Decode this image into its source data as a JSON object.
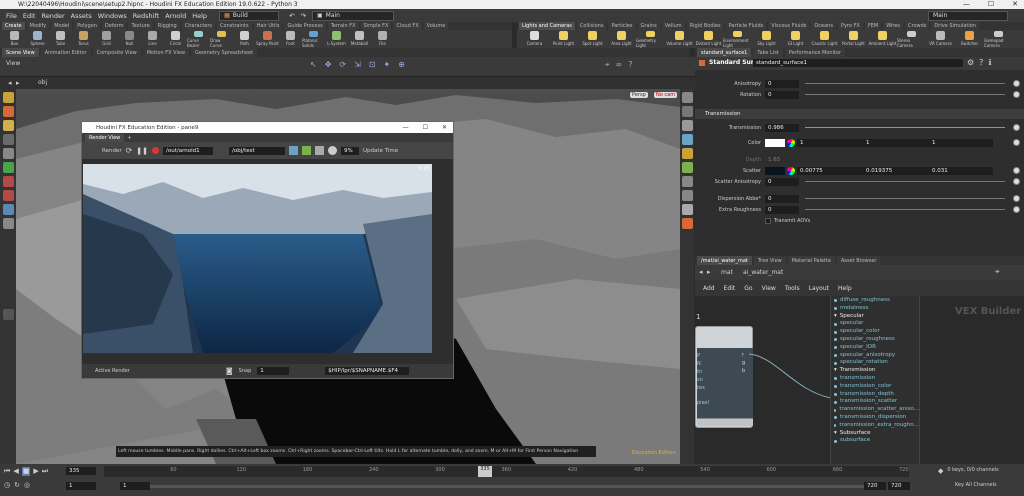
{
  "title": "W:\\22040496\\Houdini\\scene\\setup2.hipnc - Houdini FX Education Edition 19.0.622 - Python 3",
  "menu": [
    "File",
    "Edit",
    "Render",
    "Assets",
    "Windows",
    "Redshift",
    "Arnold",
    "Help"
  ],
  "build": "Build",
  "main_desk": "Main",
  "right_desk": "Main",
  "shelf_tabs_left": [
    "Create",
    "Modify",
    "Model",
    "Polygon",
    "Deform",
    "Texture",
    "Rigging",
    "Characters",
    "Constraints",
    "Hair Utils",
    "Guide Process",
    "Terrain FX",
    "Simple FX",
    "Cloud FX",
    "Volume"
  ],
  "shelf_tools_left": [
    "Box",
    "Sphere",
    "Tube",
    "Torus",
    "Grid",
    "Null",
    "Line",
    "Circle",
    "Curve Bezier",
    "Draw Curve",
    "Path",
    "Spray Paint",
    "Font",
    "Platonic Solids",
    "L-System",
    "Metaball",
    "File"
  ],
  "shelf_tabs_right": [
    "Lights and Cameras",
    "Collisions",
    "Particles",
    "Grains",
    "Vellum",
    "Rigid Bodies",
    "Particle Fluids",
    "Viscous Fluids",
    "Oceans",
    "Pyro FX",
    "FEM",
    "Wires",
    "Crowds",
    "Drive Simulation"
  ],
  "shelf_tools_right": [
    "Camera",
    "Point Light",
    "Spot Light",
    "Area Light",
    "Geometry Light",
    "Volume Light",
    "Distant Light",
    "Environment Light",
    "Sky Light",
    "GI Light",
    "Caustic Light",
    "Portal Light",
    "Ambient Light",
    "Stereo Camera",
    "VR Camera",
    "Switcher",
    "Gamepad Camera"
  ],
  "pane_tabs_left": [
    "Scene View",
    "Animation Editor",
    "Composite View",
    "Motion FX View",
    "Geometry Spreadsheet"
  ],
  "pane_tabs_right": [
    "standard_surface1",
    "Take List",
    "Performance Monitor"
  ],
  "viewer": {
    "title": "View",
    "path": "obj",
    "persp": "Persp",
    "cam": "No cam"
  },
  "render_view": {
    "title": "Houdini FX Education Edition - pane9",
    "tab": "Render View",
    "render_label": "Render",
    "out_path": "/out/arnold1",
    "obj_path": "/obj/test",
    "zoom": "9%",
    "update": "Update Time",
    "status_left": "Active Render",
    "snap_label": "Snap",
    "snap_value": "1",
    "save_path": "$HIP/lpr/$SNAPNAME.$F4",
    "corner": "0:05"
  },
  "params": {
    "node_type": "Standard Surface",
    "node_name": "standard_surface1",
    "rows_top": [
      {
        "label": "Anisotropy",
        "value": "0"
      },
      {
        "label": "Rotation",
        "value": "0"
      }
    ],
    "section": "Transmission",
    "transmission": {
      "label": "Transmission",
      "value": "0.986"
    },
    "color": {
      "label": "Color",
      "r": "1",
      "g": "1",
      "b": "1"
    },
    "depth": {
      "label": "Depth",
      "value": "1.65"
    },
    "scatter": {
      "label": "Scatter",
      "r": "0.00775",
      "g": "0.019375",
      "b": "0.031"
    },
    "scatter_aniso": {
      "label": "Scatter Anisotropy",
      "value": "0"
    },
    "dispersion": {
      "label": "Dispersion Abbe*",
      "value": "0"
    },
    "extra_rough": {
      "label": "Extra Roughness",
      "value": "0"
    },
    "transmit_aovs": "Transmit AOVs"
  },
  "net_tabs": [
    "/mat/ai_water_mat",
    "Tree View",
    "Material Palette",
    "Asset Browser"
  ],
  "net_path": [
    "mat",
    "ai_water_mat"
  ],
  "net_menu": [
    "Add",
    "Edit",
    "Go",
    "View",
    "Tools",
    "Layout",
    "Help"
  ],
  "net_title": "VEX Builder",
  "node_outputs": [
    "rgb",
    "r",
    "g",
    "b"
  ],
  "node_inputs": [
    "P",
    "N",
    "tn",
    "sn",
    "tex"
  ],
  "node_bottom": "pixel",
  "node_index": "1",
  "param_list": [
    {
      "name": "diffuse_roughness",
      "type": "item"
    },
    {
      "name": "metalness",
      "type": "item"
    },
    {
      "name": "Specular",
      "type": "header"
    },
    {
      "name": "specular",
      "type": "item"
    },
    {
      "name": "specular_color",
      "type": "item"
    },
    {
      "name": "specular_roughness",
      "type": "item"
    },
    {
      "name": "specular_IOR",
      "type": "item"
    },
    {
      "name": "specular_anisotropy",
      "type": "item"
    },
    {
      "name": "specular_rotation",
      "type": "item"
    },
    {
      "name": "Transmission",
      "type": "header"
    },
    {
      "name": "transmission",
      "type": "item"
    },
    {
      "name": "transmission_color",
      "type": "item"
    },
    {
      "name": "transmission_depth",
      "type": "item"
    },
    {
      "name": "transmission_scatter",
      "type": "item"
    },
    {
      "name": "transmission_scatter_aniso...",
      "type": "item"
    },
    {
      "name": "transmission_dispersion",
      "type": "item"
    },
    {
      "name": "transmission_extra_roughn...",
      "type": "item"
    },
    {
      "name": "Subsurface",
      "type": "header"
    },
    {
      "name": "subsurface",
      "type": "item"
    }
  ],
  "hint": "Left mouse tumbles. Middle pans. Right dollies. Ctrl+Alt+Left box zooms. Ctrl+Right zooms. Spacebar-Ctrl-Left tilts. Hold L for alternate tumble, dolly, and zoom.   M or Alt+M for First Person Navigation",
  "edu": "Education Edition",
  "timeline": {
    "frame": "335",
    "start": "1",
    "start2": "1",
    "end": "720",
    "end2": "720",
    "ticks": [
      "60",
      "120",
      "180",
      "240",
      "300",
      "360",
      "420",
      "480",
      "540",
      "600",
      "660",
      "720"
    ],
    "current": "335",
    "keys": "0 keys, 0/0 channels",
    "channels": "Key All Channels"
  }
}
